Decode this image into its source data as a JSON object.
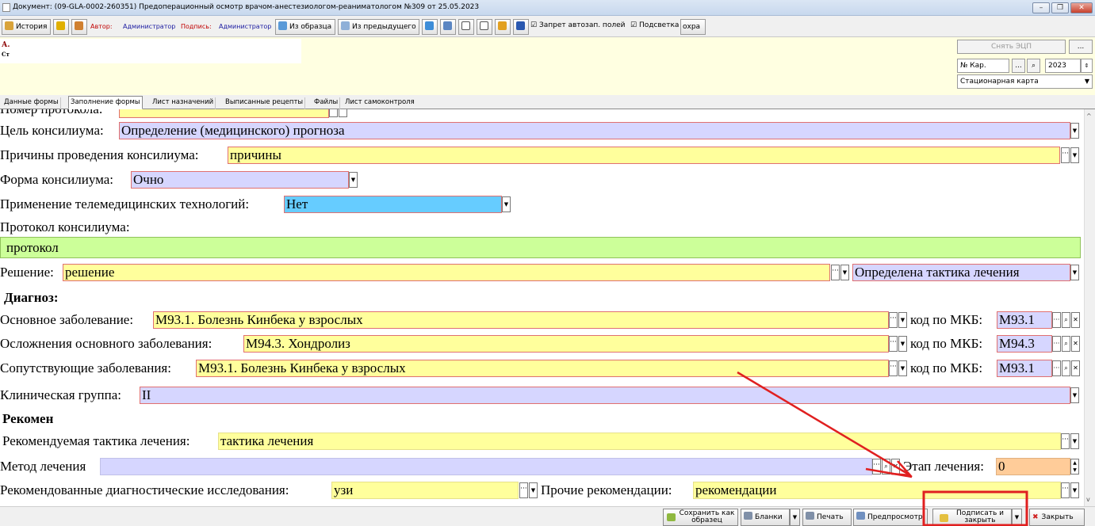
{
  "window": {
    "title": "Документ: (09-GLA-0002-260351) Предоперационный осмотр врачом-анестезиологом-реаниматологом №309 от 25.05.2023"
  },
  "toolbar": {
    "history": "История",
    "author_label": "Автор:",
    "author_value": "Администратор",
    "sign_label": "Подпись:",
    "sign_value": "Администратор",
    "from_sample": "Из образца",
    "from_previous": "Из предыдущего",
    "autofill_ban": "Запрет автозап. полей",
    "highlight": "Подсветка",
    "save_partial": "охра"
  },
  "header": {
    "line1": "А.",
    "line2": "Ст",
    "remove_ecp": "Снять ЭЦП",
    "card_number_label": "№ Кар.",
    "year": "2023",
    "card_type": "Стационарная карта"
  },
  "tabs": [
    "Данные формы",
    "Заполнение формы",
    "Лист назначений",
    "Выписанные рецепты",
    "Файлы",
    "Лист самоконтроля"
  ],
  "form": {
    "protocol_number_label": "Номер протокола:",
    "purpose_label": "Цель консилиума:",
    "purpose_value": "Определение (медицинского) прогноза",
    "reasons_label": "Причины проведения консилиума:",
    "reasons_value": "причины",
    "form_label": "Форма консилиума:",
    "form_value": "Очно",
    "telemed_label": "Применение телемедицинских технологий:",
    "telemed_value": "Нет",
    "protocol_label": "Протокол консилиума:",
    "protocol_value": "протокол",
    "decision_label": "Решение:",
    "decision_value": "решение",
    "decision_select": "Определена тактика лечения",
    "diagnosis_header": "Диагноз:",
    "main_disease_label": "Основное заболевание:",
    "main_disease_value": "M93.1. Болезнь Кинбека у взрослых",
    "complications_label": "Осложнения основного заболевания:",
    "complications_value": "M94.3. Хондролиз",
    "concomitant_label": "Сопутствующие заболевания:",
    "concomitant_value": "M93.1. Болезнь Кинбека у взрослых",
    "mkb_label": "код по МКБ:",
    "mkb1": "M93.1",
    "mkb2": "M94.3",
    "mkb3": "M93.1",
    "clinical_group_label": "Клиническая группа:",
    "clinical_group_value": "II",
    "recommendations_header": "Рекомен",
    "tactics_label": "Рекомендуемая тактика лечения:",
    "tactics_value": "тактика лечения",
    "method_label": "Метод лечения",
    "stage_label": "Этап лечения:",
    "stage_value": "0",
    "diag_research_label": "Рекомендованные диагностические исследования:",
    "diag_research_value": "узи",
    "other_rec_label": "Прочие рекомендации:",
    "other_rec_value": "рекомендации"
  },
  "bottom": {
    "save_as_sample_l1": "Сохранить как",
    "save_as_sample_l2": "образец",
    "blanks": "Бланки",
    "print": "Печать",
    "preview": "Предпросмотр",
    "sign_close_l1": "Подписать и",
    "sign_close_l2": "закрыть",
    "close": "Закрыть"
  },
  "annotation_color": "#e02020"
}
